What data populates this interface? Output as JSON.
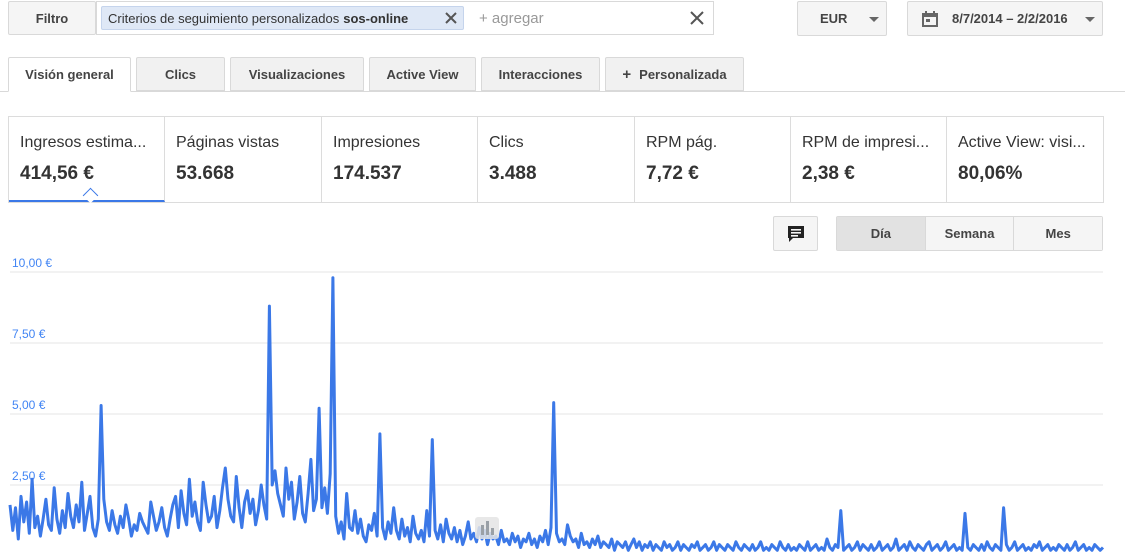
{
  "filter": {
    "button_label": "Filtro",
    "chip_text": "Criterios de seguimiento personalizados",
    "chip_value": "sos-online",
    "add_placeholder": "+ agregar"
  },
  "currency": {
    "selected": "EUR"
  },
  "date_range": {
    "label": "8/7/2014 – 2/2/2016"
  },
  "tabs": [
    {
      "label": "Visión general",
      "active": true
    },
    {
      "label": "Clics",
      "active": false
    },
    {
      "label": "Visualizaciones",
      "active": false
    },
    {
      "label": "Active View",
      "active": false
    },
    {
      "label": "Interacciones",
      "active": false
    },
    {
      "label": "Personalizada",
      "active": false
    }
  ],
  "metrics": [
    {
      "label": "Ingresos estima...",
      "value": "414,56 €",
      "selected": true
    },
    {
      "label": "Páginas vistas",
      "value": "53.668",
      "selected": false
    },
    {
      "label": "Impresiones",
      "value": "174.537",
      "selected": false
    },
    {
      "label": "Clics",
      "value": "3.488",
      "selected": false
    },
    {
      "label": "RPM pág.",
      "value": "7,72 €",
      "selected": false
    },
    {
      "label": "RPM de impresi...",
      "value": "2,38 €",
      "selected": false
    },
    {
      "label": "Active View: visi...",
      "value": "80,06%",
      "selected": false
    }
  ],
  "granularity": {
    "options": [
      "Día",
      "Semana",
      "Mes"
    ],
    "selected": "Día"
  },
  "icons": {
    "comment": "comment-icon",
    "calendar": "calendar-icon",
    "close": "close-icon",
    "dropdown": "caret-down-icon",
    "add": "plus-icon",
    "chart_marker": "bar-chart-icon"
  },
  "colors": {
    "series": "#3b78e7",
    "axis_label": "#4285f4",
    "selected_underline": "#3b78e7",
    "chip_bg": "#dfe8f6"
  },
  "chart_data": {
    "type": "line",
    "title": "",
    "xlabel": "",
    "ylabel": "",
    "ylim": [
      0,
      10
    ],
    "yticks": [
      "2,50 €",
      "5,00 €",
      "7,50 €",
      "10,00 €"
    ],
    "ytick_values": [
      2.5,
      5,
      7.5,
      10
    ],
    "grid": true,
    "series": [
      {
        "color": "#3b78e7",
        "values": [
          1.8,
          0.9,
          1.7,
          0.6,
          2.1,
          1.2,
          1.9,
          0.8,
          2.7,
          1.0,
          1.4,
          0.7,
          1.3,
          2.0,
          1.1,
          0.9,
          2.4,
          1.3,
          0.8,
          1.6,
          1.0,
          2.2,
          1.4,
          1.0,
          1.8,
          1.2,
          2.6,
          0.9,
          1.5,
          2.1,
          1.0,
          0.7,
          1.3,
          5.3,
          2.0,
          1.2,
          0.9,
          1.6,
          1.1,
          0.8,
          1.4,
          1.0,
          1.8,
          1.3,
          0.7,
          1.1,
          0.9,
          1.5,
          1.2,
          1.0,
          0.8,
          1.9,
          1.4,
          0.9,
          1.2,
          1.7,
          1.0,
          0.7,
          1.3,
          1.8,
          2.1,
          1.0,
          2.3,
          1.5,
          1.1,
          2.7,
          1.4,
          1.9,
          1.2,
          0.9,
          2.6,
          1.8,
          1.2,
          1.4,
          2.1,
          1.0,
          1.6,
          2.4,
          3.1,
          2.0,
          1.4,
          1.2,
          2.8,
          1.7,
          1.0,
          1.9,
          2.3,
          1.5,
          2.0,
          1.1,
          1.6,
          2.5,
          1.8,
          1.3,
          8.8,
          2.5,
          3.0,
          2.2,
          1.8,
          1.4,
          3.1,
          2.0,
          2.6,
          1.3,
          1.9,
          2.8,
          1.5,
          1.2,
          2.2,
          3.4,
          1.6,
          2.0,
          5.2,
          1.7,
          2.4,
          1.5,
          2.9,
          9.8,
          1.4,
          0.8,
          1.2,
          0.6,
          2.2,
          1.0,
          0.9,
          1.6,
          0.8,
          1.3,
          0.7,
          0.5,
          1.1,
          0.9,
          1.5,
          0.7,
          4.3,
          1.0,
          0.6,
          1.2,
          0.8,
          1.7,
          0.9,
          0.6,
          1.3,
          0.7,
          1.0,
          0.5,
          1.4,
          0.8,
          0.6,
          0.9,
          0.5,
          1.6,
          0.7,
          4.1,
          0.9,
          0.6,
          1.1,
          0.5,
          1.3,
          0.8,
          0.6,
          1.0,
          0.5,
          0.9,
          0.4,
          0.7,
          1.2,
          0.6,
          0.8,
          0.5,
          1.0,
          0.6,
          0.9,
          0.4,
          0.8,
          0.6,
          0.7,
          0.4,
          0.9,
          0.5,
          0.6,
          0.4,
          0.8,
          0.5,
          0.7,
          0.3,
          0.6,
          0.5,
          0.8,
          0.4,
          0.6,
          0.3,
          0.7,
          0.5,
          0.9,
          0.4,
          1.0,
          5.4,
          0.8,
          0.5,
          0.6,
          0.4,
          1.1,
          0.7,
          0.5,
          0.6,
          0.3,
          0.8,
          0.4,
          0.5,
          0.3,
          0.6,
          0.4,
          0.7,
          0.3,
          0.5,
          0.4,
          0.3,
          0.6,
          0.2,
          0.5,
          0.4,
          0.3,
          0.5,
          0.2,
          0.4,
          0.6,
          0.3,
          0.5,
          0.2,
          0.4,
          0.3,
          0.5,
          0.2,
          0.4,
          0.3,
          0.2,
          0.5,
          0.3,
          0.4,
          0.2,
          0.3,
          0.5,
          0.2,
          0.4,
          0.3,
          0.2,
          0.4,
          0.3,
          0.5,
          0.2,
          0.3,
          0.4,
          0.2,
          0.3,
          0.5,
          0.2,
          0.4,
          0.3,
          0.2,
          0.4,
          0.3,
          0.2,
          0.5,
          0.3,
          0.2,
          0.4,
          0.3,
          0.2,
          0.4,
          0.2,
          0.3,
          0.5,
          0.2,
          0.3,
          0.2,
          0.4,
          0.3,
          0.2,
          0.5,
          0.3,
          0.2,
          0.4,
          0.2,
          0.3,
          0.2,
          0.4,
          0.3,
          0.2,
          0.5,
          0.2,
          0.3,
          0.4,
          0.2,
          0.3,
          0.2,
          0.6,
          0.3,
          0.2,
          0.4,
          0.3,
          1.6,
          0.2,
          0.3,
          0.4,
          0.2,
          0.3,
          0.5,
          0.2,
          0.4,
          0.3,
          0.2,
          0.4,
          0.2,
          0.3,
          0.5,
          0.2,
          0.3,
          0.4,
          0.2,
          0.3,
          0.6,
          0.2,
          0.3,
          0.4,
          0.2,
          0.5,
          0.3,
          0.2,
          0.4,
          0.3,
          0.2,
          0.4,
          0.5,
          0.2,
          0.3,
          0.4,
          0.2,
          0.3,
          0.5,
          0.2,
          0.3,
          0.4,
          0.2,
          0.3,
          0.2,
          1.5,
          0.3,
          0.2,
          0.4,
          0.3,
          0.2,
          0.4,
          0.2,
          0.5,
          0.3,
          0.2,
          0.4,
          0.3,
          0.2,
          1.7,
          0.4,
          0.2,
          0.3,
          0.5,
          0.2,
          0.3,
          0.4,
          0.2,
          0.3,
          0.2,
          0.4,
          0.3,
          0.5,
          0.2,
          0.3,
          0.4,
          0.2,
          0.3,
          0.2,
          0.4,
          0.3,
          0.2,
          0.4,
          0.2,
          0.3,
          0.5,
          0.2,
          0.3,
          0.4,
          0.2,
          0.3,
          0.2,
          0.4,
          0.3,
          0.2,
          0.3
        ]
      }
    ]
  }
}
